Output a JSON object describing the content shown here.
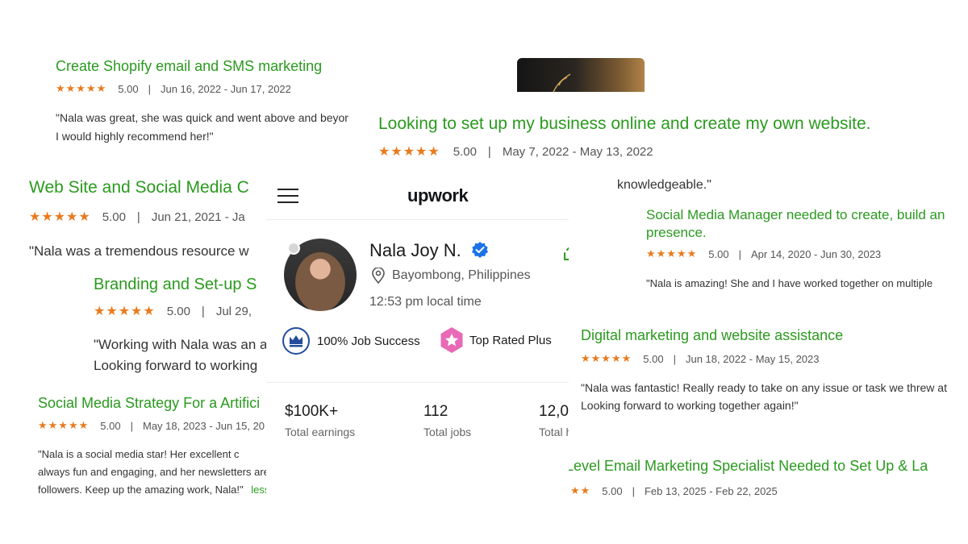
{
  "colors": {
    "accent_green": "#2a9a1e",
    "star_orange": "#e87b1e",
    "verified_blue": "#1a73e8",
    "top_rated_pink": "#e86ab7",
    "job_success_navy": "#244c9c"
  },
  "reviews": {
    "shopify": {
      "title": "Create Shopify email and SMS marketing",
      "stars": "★★★★★",
      "rating": "5.00",
      "dates": "Jun 16, 2022 - Jun 17, 2022",
      "quote_1": "\"Nala was great, she was quick and went above and beyor",
      "quote_2": "I would highly recommend her!\""
    },
    "business": {
      "title": "Looking to set up my business online and create my own website.",
      "stars": "★★★★★",
      "rating": "5.00",
      "dates": "May 7, 2022 - May 13, 2022",
      "quote_1": "knowledgeable.\""
    },
    "website_social": {
      "title": "Web Site and Social Media C",
      "stars": "★★★★★",
      "rating": "5.00",
      "dates": "Jun 21, 2021 - Ja",
      "quote_1": "\"Nala was a tremendous resource w"
    },
    "branding": {
      "title": "Branding and Set-up S",
      "stars": "★★★★★",
      "rating": "5.00",
      "dates": "Jul 29,",
      "quote_1": "\"Working with Nala was an a",
      "quote_2": "Looking forward to working"
    },
    "social_manager": {
      "title_1": "Social Media Manager needed to create, build an",
      "title_2": "presence.",
      "stars": "★★★★★",
      "rating": "5.00",
      "dates": "Apr 14, 2020 - Jun 30, 2023",
      "quote_1": "\"Nala is amazing! She and I have worked together on multiple"
    },
    "digital": {
      "title": "Digital marketing and website assistance",
      "stars": "★★★★★",
      "rating": "5.00",
      "dates": "Jun 18, 2022 - May 15, 2023",
      "quote_1": "\"Nala was fantastic! Really ready to take on any issue or task we threw at",
      "quote_2": "Looking forward to working together again!\""
    },
    "strategy": {
      "title": "Social Media Strategy For a Artifici",
      "stars": "★★★★★",
      "rating": "5.00",
      "dates": "May 18, 2023 - Jun 15, 20",
      "quote_1": "\"Nala is a social media star! Her excellent c",
      "quote_2": "always fun and engaging, and her newsletters are a treat to read. Plus, she's great at chatting",
      "quote_3": "followers. Keep up the amazing work, Nala!\"",
      "less": "less"
    },
    "highlevel": {
      "title": "HighLevel Email Marketing Specialist Needed to Set Up & La",
      "stars": "★★★★★",
      "rating": "5.00",
      "dates": "Feb 13, 2025 - Feb 22, 2025"
    }
  },
  "profile": {
    "brand": "upwork",
    "name": "Nala Joy N.",
    "location": "Bayombong, Philippines",
    "local_time": "12:53 pm local time",
    "badges": {
      "job_success": "100% Job Success",
      "top_rated": "Top Rated Plus"
    },
    "stats": [
      {
        "value": "$100K+",
        "label": "Total earnings"
      },
      {
        "value": "112",
        "label": "Total jobs"
      },
      {
        "value": "12,0",
        "label": "Total hours"
      }
    ]
  },
  "icons": [
    "menu-icon",
    "search-icon",
    "verified-icon",
    "location-icon",
    "share-icon",
    "crown-icon",
    "star-badge-icon",
    "online-dot-icon"
  ]
}
